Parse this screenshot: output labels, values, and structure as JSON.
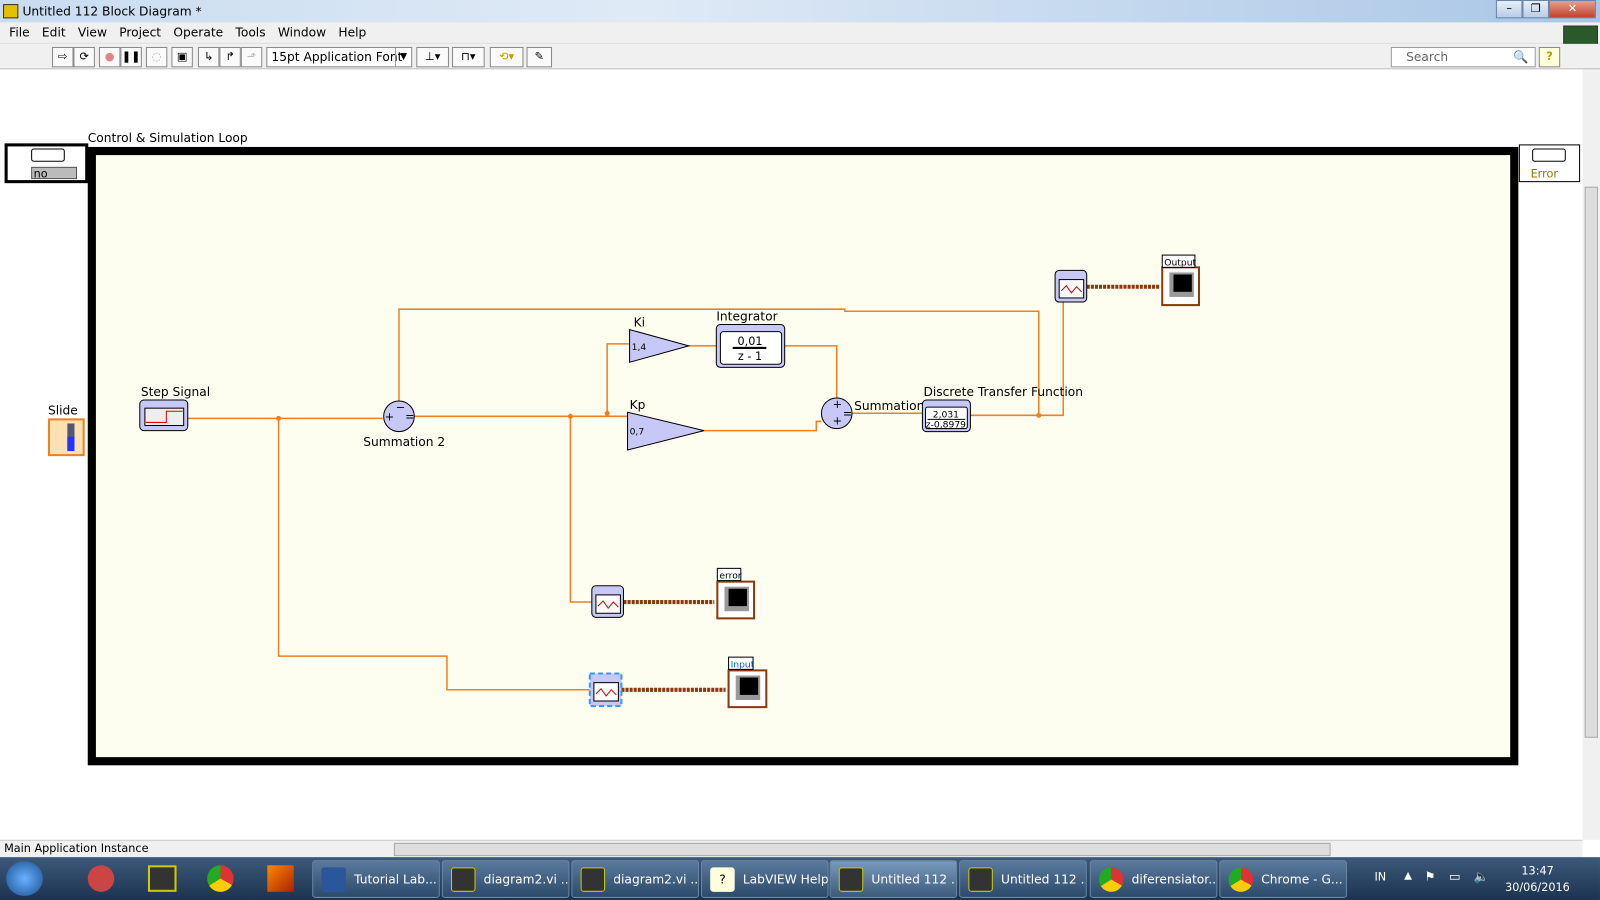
{
  "window": {
    "title": "Untitled 112 Block Diagram *",
    "controls": [
      "–",
      "❐",
      "✕"
    ]
  },
  "menu": [
    "File",
    "Edit",
    "View",
    "Project",
    "Operate",
    "Tools",
    "Window",
    "Help"
  ],
  "toolbar": {
    "font": "15pt Application Font",
    "search_placeholder": "Search",
    "help": "?"
  },
  "diagram": {
    "loop_label": "Control & Simulation Loop",
    "left_node_value": "no",
    "right_node_value": "Error",
    "slide_label": "Slide",
    "step_label": "Step Signal",
    "sum2_label": "Summation 2",
    "ki_label": "Ki",
    "ki_value": "1,4",
    "kp_label": "Kp",
    "kp_value": "0,7",
    "integrator_label": "Integrator",
    "integrator_num": "0,01",
    "integrator_den": "z - 1",
    "sum_label": "Summation",
    "dtf_label": "Discrete Transfer Function",
    "dtf_num": "2,031",
    "dtf_den": "z-0,8979",
    "output_label": "Output",
    "error_label": "error",
    "input_label": "Input"
  },
  "statusbar": {
    "context": "Main Application Instance"
  },
  "taskbar": {
    "items": [
      "Tutorial Lab...",
      "diagram2.vi ...",
      "diagram2.vi ...",
      "LabVIEW Help",
      "Untitled 112 ...",
      "Untitled 112 ...",
      "diferensiator...",
      "Chrome - G..."
    ],
    "lang": "IN",
    "time": "13:47",
    "date": "30/06/2016"
  },
  "colors": {
    "wire": "#f08020",
    "block": "#c8c8f8",
    "loop_bg": "#fefef0",
    "array_wire": "#8b3a10"
  }
}
